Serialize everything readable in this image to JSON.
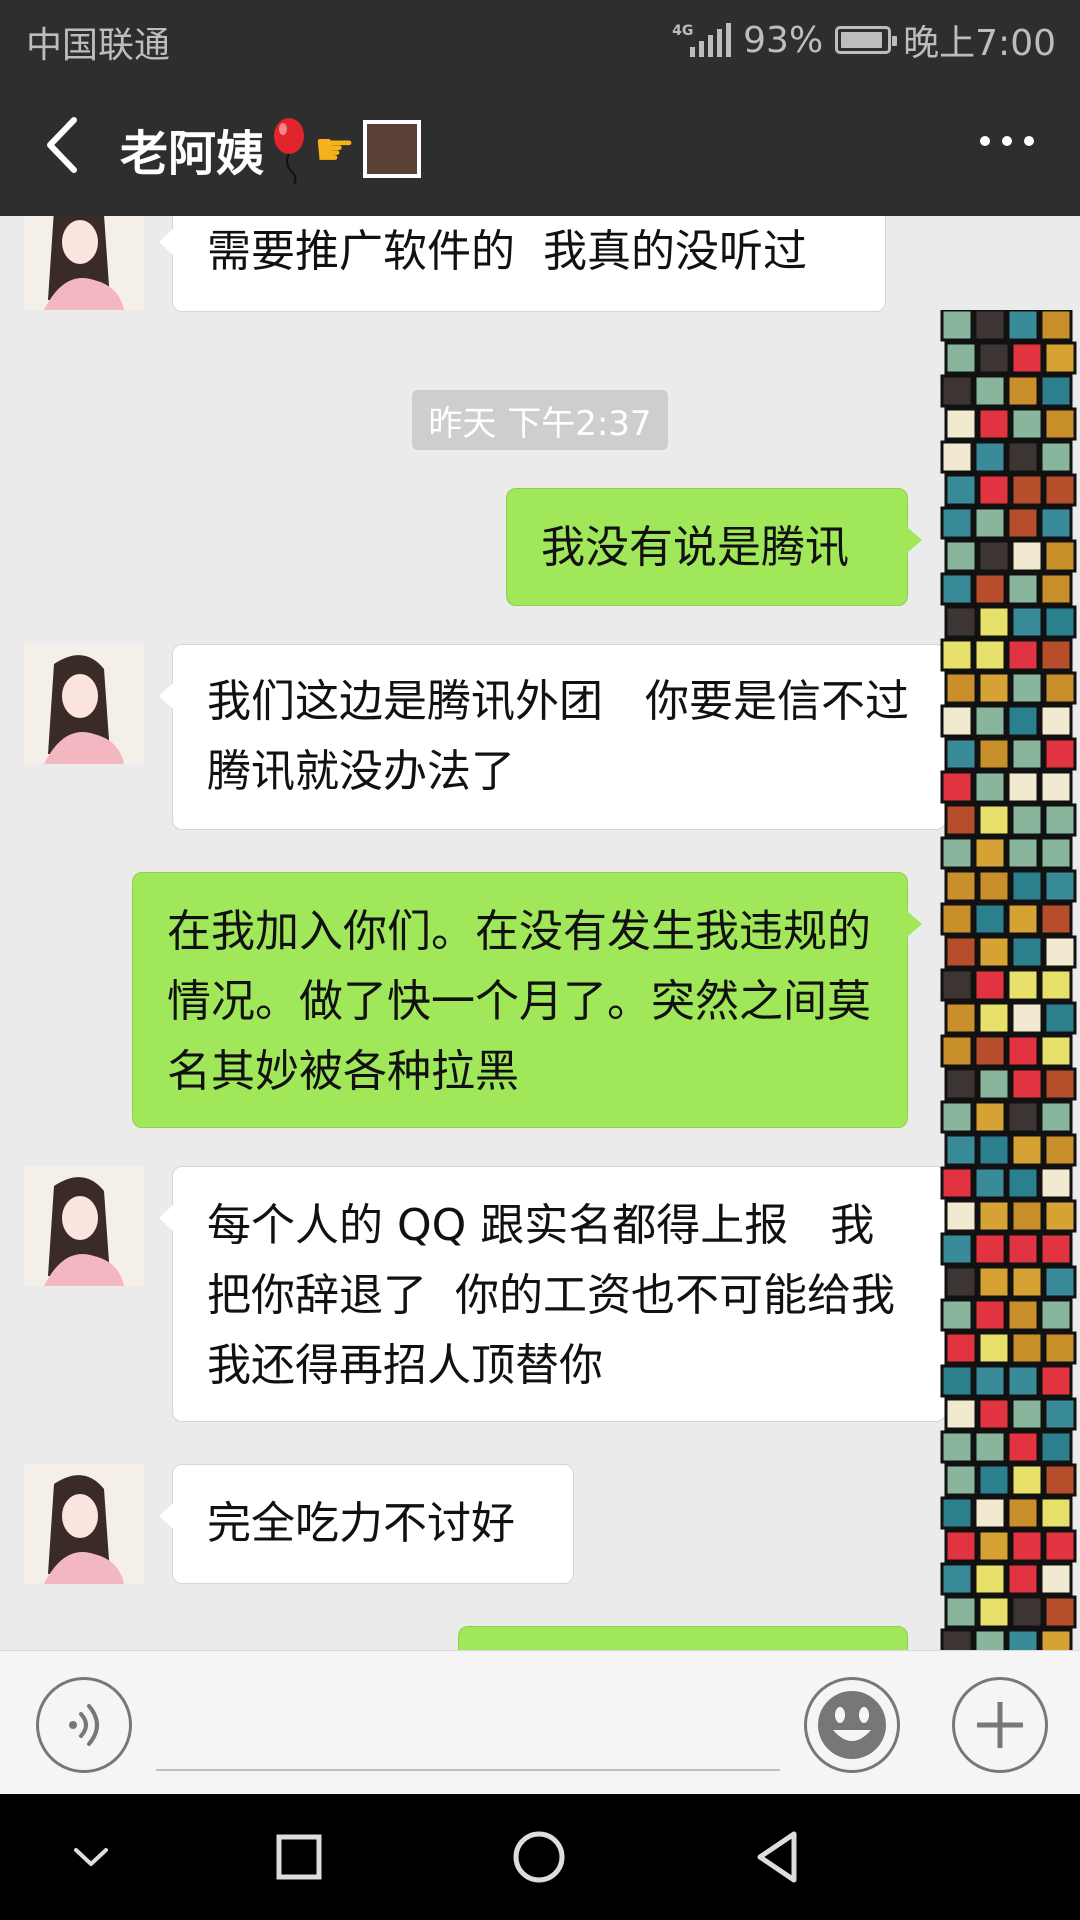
{
  "status_bar": {
    "carrier": "中国联通",
    "network": "4G",
    "battery": "93%",
    "battery_level": 0.93,
    "time": "晚上7:00"
  },
  "header": {
    "contact_name": "老阿姨",
    "emoji": [
      "balloon-icon",
      "pointing-hand-icon",
      "brown-square-icon"
    ]
  },
  "messages": [
    {
      "side": "incoming",
      "text": "需要推广软件的  我真的没听过"
    },
    {
      "type": "timestamp",
      "text": "昨天 下午2:37"
    },
    {
      "side": "outgoing",
      "text": "我没有说是腾讯"
    },
    {
      "side": "incoming",
      "text": "我们这边是腾讯外团   你要是信不过腾讯就没办法了"
    },
    {
      "side": "outgoing",
      "text": "在我加入你们。在没有发生我违规的情况。做了快一个月了。突然之间莫名其妙被各种拉黑"
    },
    {
      "side": "incoming",
      "text": "每个人的 QQ 跟实名都得上报   我把你辞退了  你的工资也不可能给我    我还得再招人顶替你"
    },
    {
      "side": "incoming",
      "text": "完全吃力不讨好"
    },
    {
      "side": "outgoing",
      "text": ""
    }
  ],
  "colors": {
    "header_bg": "#2e2e2e",
    "chat_bg": "#ebebeb",
    "outgoing_bubble": "#a0e75a",
    "incoming_bubble": "#ffffff"
  },
  "input_bar": {
    "icons": [
      "voice-icon",
      "emoji-icon",
      "plus-icon"
    ]
  },
  "nav_bar": {
    "icons": [
      "hide-keyboard-icon",
      "recents-icon",
      "home-icon",
      "back-icon"
    ]
  }
}
